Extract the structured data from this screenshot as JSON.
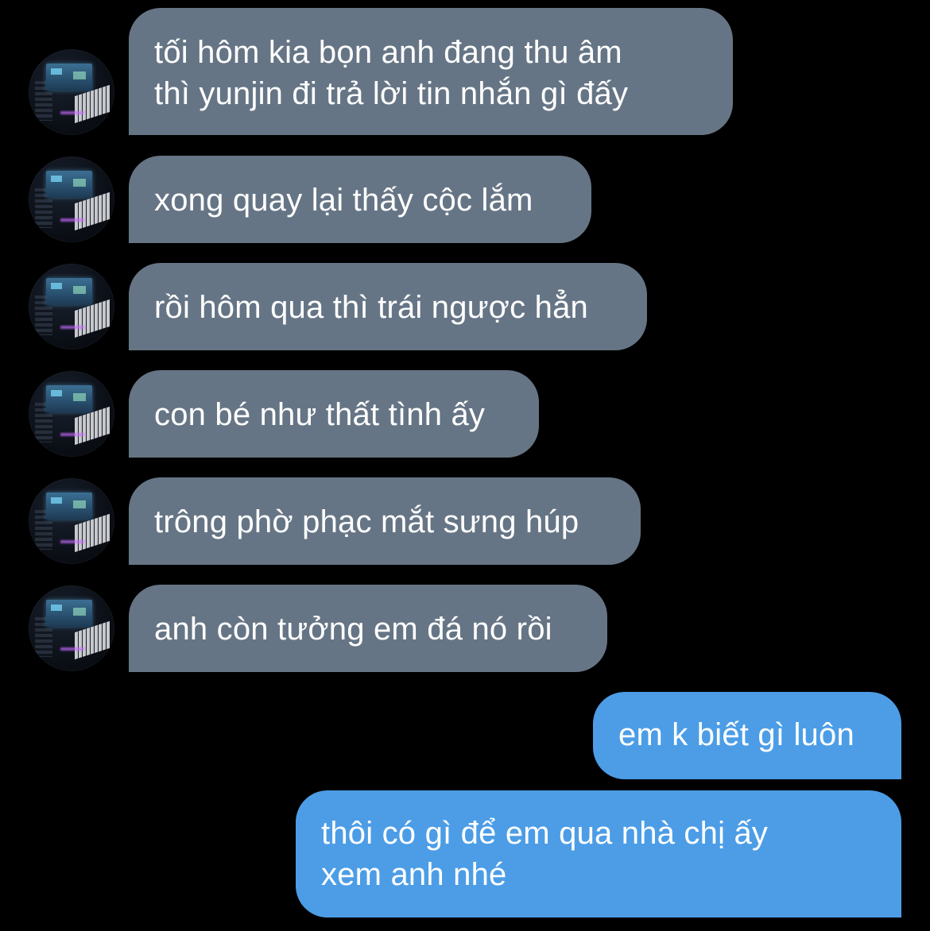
{
  "conversation": {
    "incoming": [
      {
        "text": "tối hôm kia bọn anh đang thu âm\nthì yunjin đi trả lời tin nhắn gì đấy"
      },
      {
        "text": "xong quay lại thấy cộc lắm"
      },
      {
        "text": "rồi hôm qua thì trái ngược hẳn"
      },
      {
        "text": "con bé như thất tình ấy"
      },
      {
        "text": "trông phờ phạc mắt sưng húp"
      },
      {
        "text": "anh còn tưởng em đá nó rồi"
      }
    ],
    "outgoing": [
      {
        "text": "em k biết gì luôn"
      },
      {
        "text": "thôi có gì để em qua nhà chị ấy\nxem anh nhé"
      }
    ]
  },
  "colors": {
    "background": "#000000",
    "incoming_bubble": "#667585",
    "outgoing_bubble": "#4c9de6",
    "text": "#ffffff"
  },
  "icons": {
    "avatar": "studio-photo-avatar-icon"
  }
}
